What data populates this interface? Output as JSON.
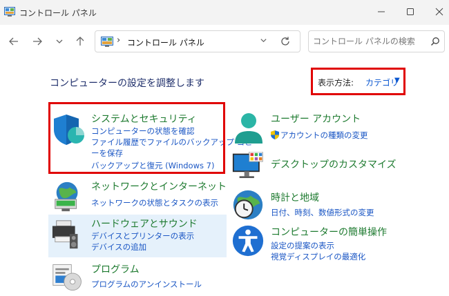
{
  "window": {
    "title": "コントロール パネル"
  },
  "address": {
    "path": "コントロール パネル",
    "separator": "›",
    "search_placeholder": "コントロール パネルの検索"
  },
  "main": {
    "heading": "コンピューターの設定を調整します",
    "view_by_label": "表示方法:",
    "view_by_value": "カテゴリ"
  },
  "categories": [
    {
      "id": "system-security",
      "title": "システムとセキュリティ",
      "links": [
        "コンピューターの状態を確認",
        "ファイル履歴でファイルのバックアップ コピー",
        "ーを保存",
        "バックアップと復元 (Windows 7)"
      ]
    },
    {
      "id": "network",
      "title": "ネットワークとインターネット",
      "links": [
        "ネットワークの状態とタスクの表示"
      ]
    },
    {
      "id": "hardware",
      "title": "ハードウェアとサウンド",
      "links": [
        "デバイスとプリンターの表示",
        "デバイスの追加"
      ]
    },
    {
      "id": "programs",
      "title": "プログラム",
      "links": [
        "プログラムのアンインストール"
      ]
    },
    {
      "id": "user-accounts",
      "title": "ユーザー アカウント",
      "links": [
        "アカウントの種類の変更"
      ]
    },
    {
      "id": "appearance",
      "title": "デスクトップのカスタマイズ",
      "links": []
    },
    {
      "id": "clock-region",
      "title": "時計と地域",
      "links": [
        "日付、時刻、数値形式の変更"
      ]
    },
    {
      "id": "ease-of-access",
      "title": "コンピューターの簡単操作",
      "links": [
        "設定の提案の表示",
        "視覚ディスプレイの最適化"
      ]
    }
  ],
  "colors": {
    "highlight": "#e00000",
    "link": "#1a56c4",
    "category_title": "#1d7a2f"
  }
}
